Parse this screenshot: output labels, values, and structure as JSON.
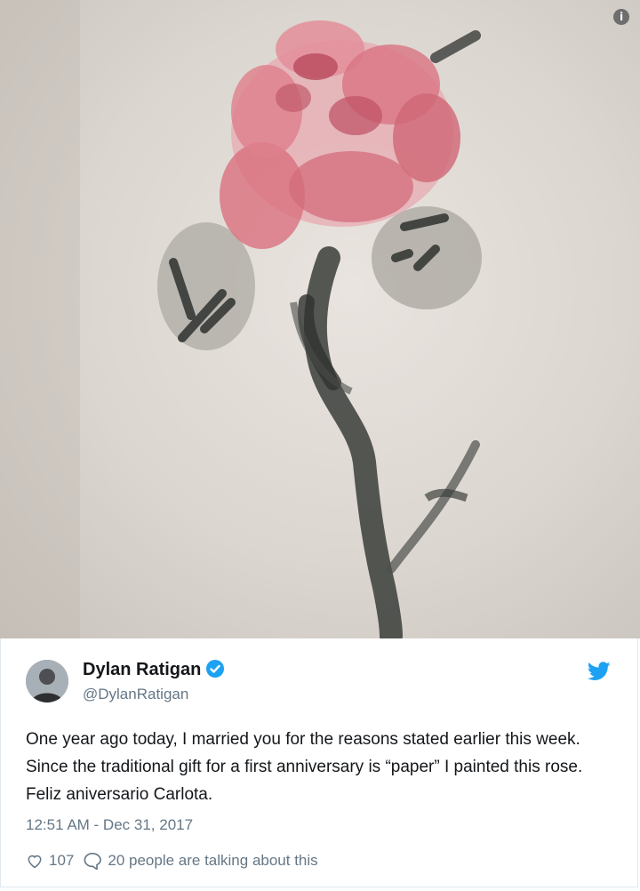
{
  "tweet": {
    "author_name": "Dylan Ratigan",
    "author_handle": "@DylanRatigan",
    "text": "One year ago today, I married you for the reasons stated earlier this week. Since the traditional gift for a first anniversary is “paper” I painted this rose. Feliz aniversario Carlota.",
    "timestamp": "12:51 AM - Dec 31, 2017",
    "like_count": "107",
    "reply_text": "20 people are talking about this"
  },
  "image": {
    "info_glyph": "i"
  },
  "icons": [
    "info-icon",
    "verified-badge-icon",
    "twitter-bird-icon",
    "heart-icon",
    "comment-icon"
  ],
  "colors": {
    "twitter_blue": "#1da1f2",
    "text": "#14171a",
    "secondary": "#657786",
    "rose": "#d9707e"
  }
}
